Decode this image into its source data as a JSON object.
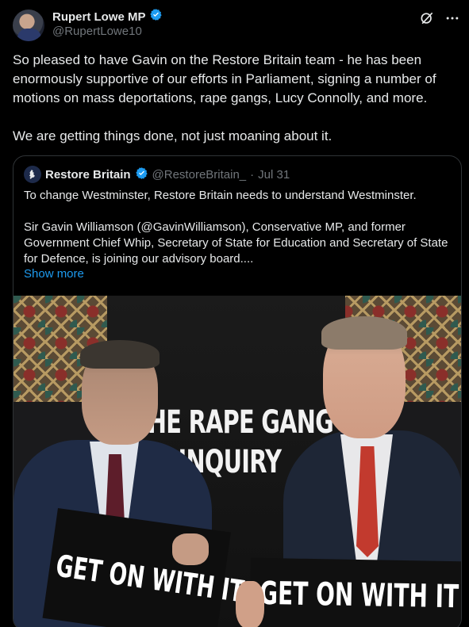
{
  "post": {
    "author_name": "Rupert Lowe MP",
    "author_handle": "@RupertLowe10",
    "body": [
      "So pleased to have Gavin on the Restore Britain team - he has been enormously supportive of our efforts in Parliament, signing a number of motions on mass deportations, rape gangs, Lucy Connolly, and more.",
      "We are getting things done, not just moaning about it."
    ],
    "icons": {
      "verified": "verified-badge-icon",
      "grok": "grok-icon",
      "more": "more-icon"
    }
  },
  "quote": {
    "author_name": "Restore Britain",
    "author_handle": "@RestoreBritain_",
    "separator": "·",
    "date": "Jul 31",
    "body": [
      "To change Westminster, Restore Britain needs to understand Westminster.",
      "Sir Gavin Williamson (@GavinWilliamson), Conservative MP, and former Government Chief Whip, Secretary of State for Education and Secretary of State for Defence, is joining our advisory board...."
    ],
    "show_more": "Show more",
    "image": {
      "banner_line1": "THE RAPE GANG",
      "banner_line2": "INQUIRY",
      "sign_left": "GET ON WITH IT.",
      "sign_right": "GET ON WITH IT"
    }
  },
  "colors": {
    "accent": "#1d9bf0",
    "verified": "#1d9bf0",
    "muted": "#71767b",
    "background": "#000000"
  }
}
